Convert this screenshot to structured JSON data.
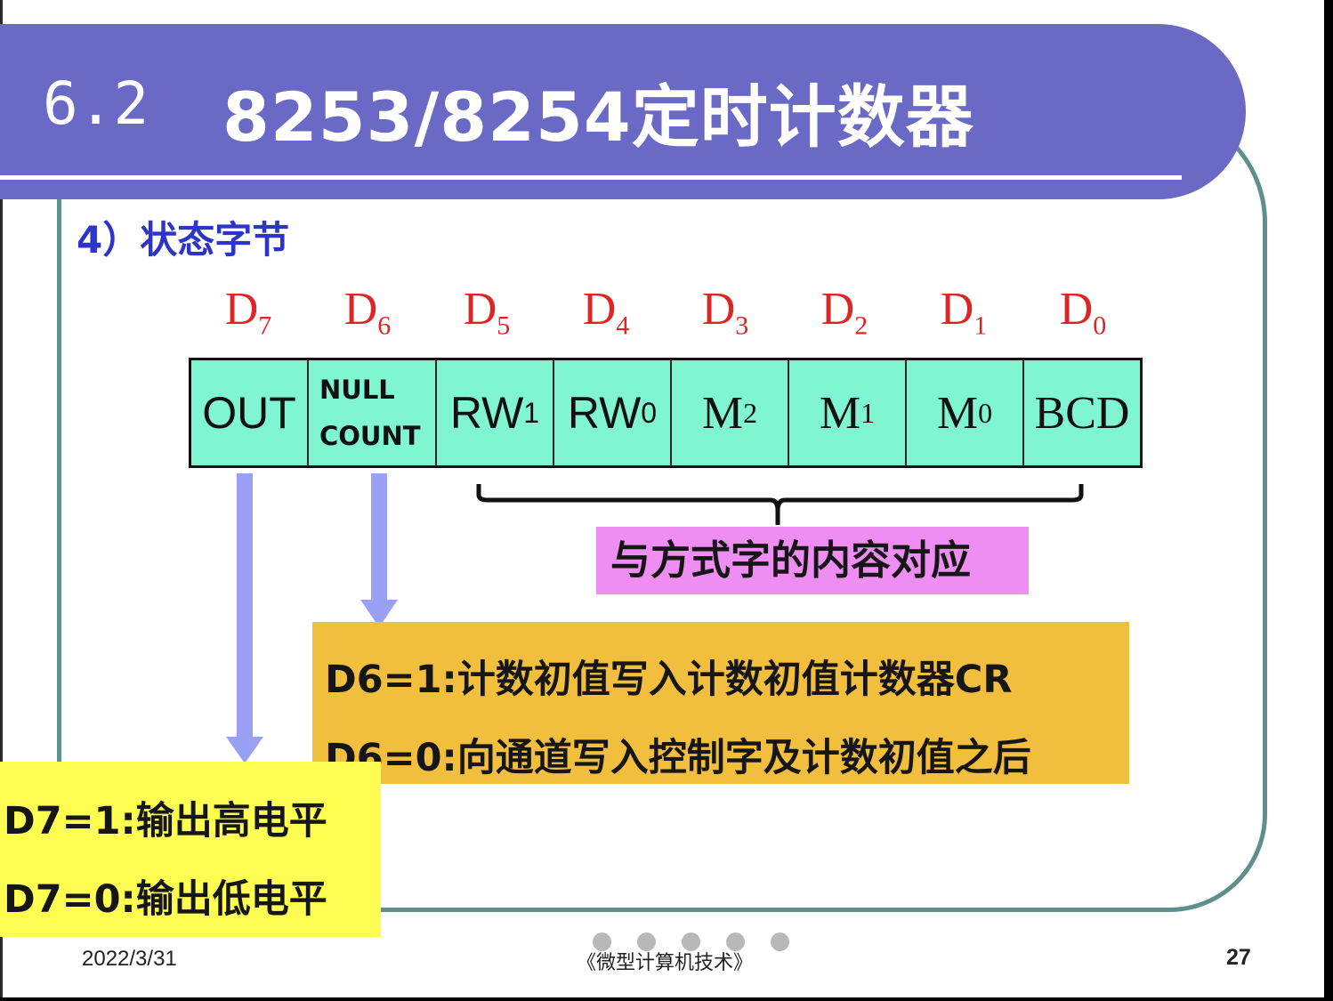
{
  "slide": {
    "title_number": "6.2",
    "title_text": "8253/8254定时计数器",
    "subtitle": "4）状态字节",
    "bit_labels": [
      {
        "base": "D",
        "sub": "7"
      },
      {
        "base": "D",
        "sub": "6"
      },
      {
        "base": "D",
        "sub": "5"
      },
      {
        "base": "D",
        "sub": "4"
      },
      {
        "base": "D",
        "sub": "3"
      },
      {
        "base": "D",
        "sub": "2"
      },
      {
        "base": "D",
        "sub": "1"
      },
      {
        "base": "D",
        "sub": "0"
      }
    ],
    "cells": {
      "out": "OUT",
      "null_line1": "NULL",
      "null_line2": "COUNT",
      "rw1_base": "RW",
      "rw1_sub": "1",
      "rw0_base": "RW",
      "rw0_sub": "0",
      "m2_base": "M",
      "m2_sub": "2",
      "m1_base": "M",
      "m1_sub": "1",
      "m0_base": "M",
      "m0_sub": "0",
      "bcd": "BCD"
    },
    "note_magenta": "与方式字的内容对应",
    "note_orange": [
      "D6=1:计数初值写入计数初值计数器CR",
      "D6=0:向通道写入控制字及计数初值之后"
    ],
    "note_yellow": [
      "D7=1:输出高电平",
      "D7=0:输出低电平"
    ]
  },
  "footer": {
    "date": "2022/3/31",
    "course": "《微型计算机技术》",
    "page": "27"
  },
  "colors": {
    "title_bar": "#6a69c6",
    "bit_label": "#e02424",
    "cell_fill": "#7ff5d1",
    "subtitle": "#2d35c8",
    "arrow": "#9aa0f5",
    "note_magenta": "#ee8ef2",
    "note_orange": "#f2be3e",
    "note_yellow": "#fdfd52"
  }
}
